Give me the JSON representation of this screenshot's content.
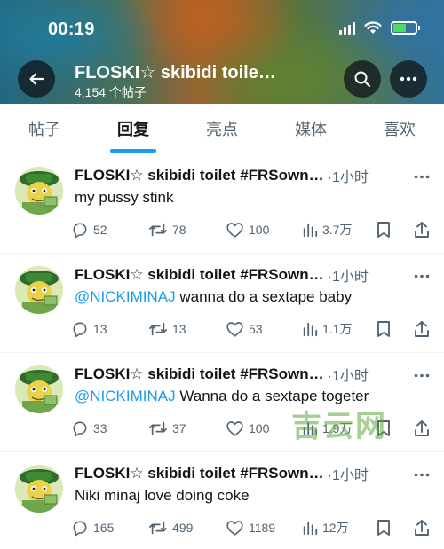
{
  "status_bar": {
    "time": "00:19"
  },
  "header": {
    "title": "FLOSKI☆ skibidi toile…",
    "post_count": "4,154 个帖子"
  },
  "tabs": [
    {
      "label": "帖子",
      "active": false
    },
    {
      "label": "回复",
      "active": true
    },
    {
      "label": "亮点",
      "active": false
    },
    {
      "label": "媒体",
      "active": false
    },
    {
      "label": "喜欢",
      "active": false
    }
  ],
  "posts": [
    {
      "author": "FLOSKI☆ skibidi toilet #FRSown…",
      "time": "·1小时",
      "mention": "",
      "text": "my pussy stink",
      "replies": "52",
      "reposts": "78",
      "likes": "100",
      "views": "3.7万"
    },
    {
      "author": "FLOSKI☆ skibidi toilet #FRSown…",
      "time": "·1小时",
      "mention": "@NICKIMINAJ",
      "text": " wanna do a sextape baby",
      "replies": "13",
      "reposts": "13",
      "likes": "53",
      "views": "1.1万"
    },
    {
      "author": "FLOSKI☆ skibidi toilet #FRSown…",
      "time": "·1小时",
      "mention": "@NICKIMINAJ",
      "text": " Wanna do a sextape togeter",
      "replies": "33",
      "reposts": "37",
      "likes": "100",
      "views": "1.9万"
    },
    {
      "author": "FLOSKI☆ skibidi toilet #FRSown…",
      "time": "·1小时",
      "mention": "",
      "text": "Niki minaj love doing coke",
      "replies": "165",
      "reposts": "499",
      "likes": "1189",
      "views": "12万"
    }
  ],
  "watermark": "吉云网",
  "colors": {
    "accent": "#1d9bf0",
    "text": "#0f1419",
    "muted": "#536471"
  },
  "icons": [
    "back-arrow-icon",
    "search-icon",
    "more-icon",
    "reply-icon",
    "repost-icon",
    "like-icon",
    "views-icon",
    "bookmark-icon",
    "share-icon",
    "wifi-icon",
    "signal-icon",
    "battery-icon"
  ]
}
